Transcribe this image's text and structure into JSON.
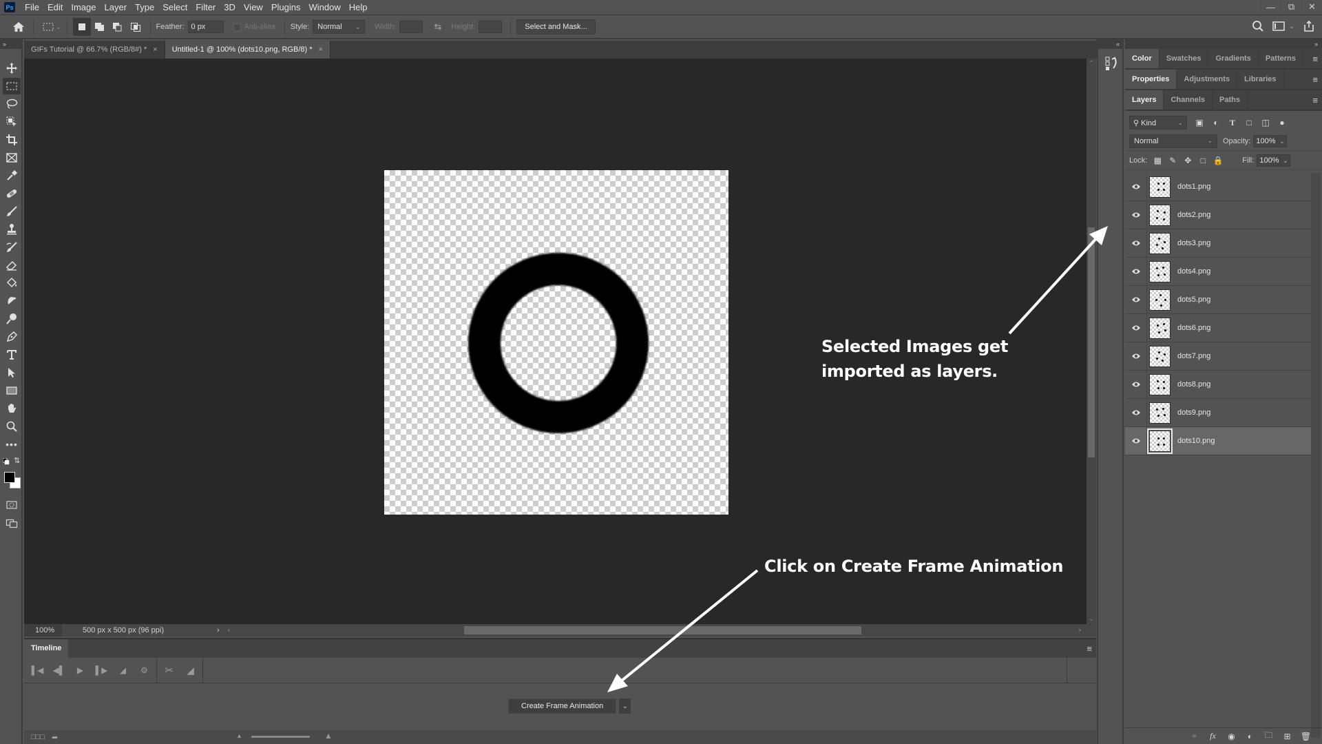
{
  "app": {
    "logo": "Ps",
    "menu": [
      "File",
      "Edit",
      "Image",
      "Layer",
      "Type",
      "Select",
      "Filter",
      "3D",
      "View",
      "Plugins",
      "Window",
      "Help"
    ],
    "window_controls": [
      "minimize",
      "restore",
      "close"
    ]
  },
  "options_bar": {
    "feather_label": "Feather:",
    "feather_value": "0 px",
    "anti_alias_label": "Anti-alias",
    "style_label": "Style:",
    "style_value": "Normal",
    "width_label": "Width:",
    "height_label": "Height:",
    "select_mask_label": "Select and Mask..."
  },
  "toolbar": {
    "expand_glyph": "»",
    "tools": [
      "move",
      "rectangular-marquee",
      "lasso",
      "object-selection",
      "crop",
      "frame",
      "eyedropper",
      "healing-brush",
      "brush",
      "clone-stamp",
      "history-brush",
      "eraser",
      "paint-bucket",
      "smudge",
      "dodge",
      "pen",
      "type",
      "path-selection",
      "rectangle",
      "hand",
      "zoom",
      "edit-toolbar"
    ],
    "active_tool": "rectangular-marquee",
    "foreground_color": "#000000",
    "background_color": "#ffffff"
  },
  "documents": {
    "tabs": [
      {
        "label": "GIFs Tutorial @ 66.7% (RGB/8#) *",
        "active": false
      },
      {
        "label": "Untitled-1 @ 100% (dots10.png, RGB/8) *",
        "active": true
      }
    ],
    "close_glyph": "×"
  },
  "status": {
    "zoom": "100%",
    "doc_info": "500 px x 500 px (96 ppi)",
    "expand_glyph": "›",
    "scroll_left_glyph": "‹",
    "scroll_right_glyph": "›"
  },
  "timeline": {
    "title": "Timeline",
    "create_button": "Create Frame Animation",
    "controls": [
      "first-frame",
      "previous-frame",
      "play",
      "next-frame",
      "audio",
      "settings",
      "split",
      "transition"
    ]
  },
  "panels": {
    "group1_tabs": [
      "Color",
      "Swatches",
      "Gradients",
      "Patterns"
    ],
    "group2_tabs": [
      "Properties",
      "Adjustments",
      "Libraries"
    ],
    "group3_tabs": [
      "Layers",
      "Channels",
      "Paths"
    ],
    "collapse_glyph": "«",
    "expand_glyph": "»"
  },
  "layers": {
    "filter_kind": "Kind",
    "blend_mode": "Normal",
    "opacity_label": "Opacity:",
    "opacity_value": "100%",
    "lock_label": "Lock:",
    "fill_label": "Fill:",
    "fill_value": "100%",
    "items": [
      {
        "name": "dots1.png",
        "visible": true,
        "selected": false
      },
      {
        "name": "dots2.png",
        "visible": true,
        "selected": false
      },
      {
        "name": "dots3.png",
        "visible": true,
        "selected": false
      },
      {
        "name": "dots4.png",
        "visible": true,
        "selected": false
      },
      {
        "name": "dots5.png",
        "visible": true,
        "selected": false
      },
      {
        "name": "dots6.png",
        "visible": true,
        "selected": false
      },
      {
        "name": "dots7.png",
        "visible": true,
        "selected": false
      },
      {
        "name": "dots8.png",
        "visible": true,
        "selected": false
      },
      {
        "name": "dots9.png",
        "visible": true,
        "selected": false
      },
      {
        "name": "dots10.png",
        "visible": true,
        "selected": true
      }
    ]
  },
  "annotations": {
    "layers_note_line1": "Selected Images get",
    "layers_note_line2": "imported as layers.",
    "timeline_note": "Click on Create Frame Animation",
    "color": "#ffffff"
  }
}
